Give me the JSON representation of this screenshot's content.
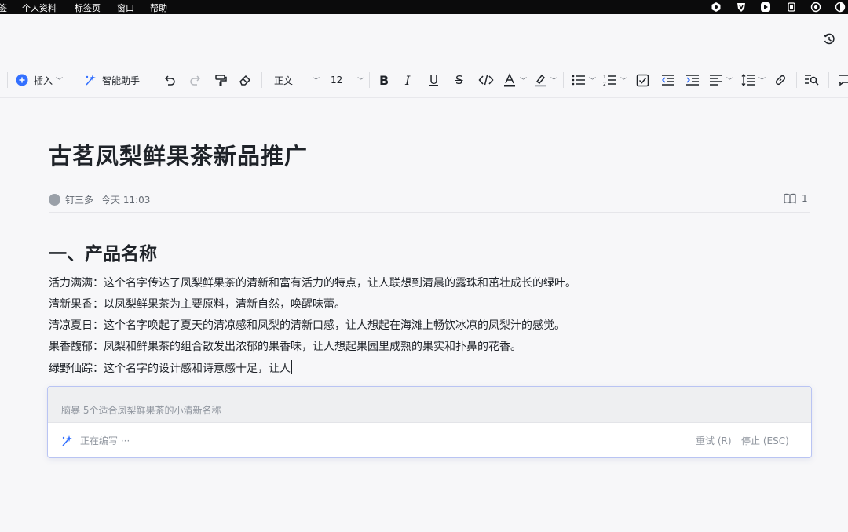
{
  "menubar": {
    "items": [
      "签",
      "个人资料",
      "标签页",
      "窗口",
      "帮助"
    ]
  },
  "toolbar": {
    "insert_label": "插入",
    "assistant_label": "智能助手",
    "style_label": "正文",
    "font_size": "12",
    "icons": [
      "plus-icon",
      "sparkle-icon",
      "undo-icon",
      "redo-icon",
      "format-painter-icon",
      "eraser-icon",
      "bold-icon",
      "italic-icon",
      "underline-icon",
      "strikethrough-icon",
      "code-icon",
      "font-color-icon",
      "highlight-icon",
      "bulleted-list-icon",
      "numbered-list-icon",
      "checkbox-icon",
      "outdent-icon",
      "indent-icon",
      "align-icon",
      "line-spacing-icon",
      "link-icon",
      "find-icon",
      "comment-icon"
    ],
    "accent_color": "#3370ff"
  },
  "document": {
    "title": "古茗凤梨鲜果茶新品推广",
    "author": "钉三多",
    "updated": "今天 11:03",
    "read_count": "1",
    "section_heading": "一、产品名称",
    "paragraphs": [
      "活力满满：这个名字传达了凤梨鲜果茶的清新和富有活力的特点，让人联想到清晨的露珠和茁壮成长的绿叶。",
      "清新果香：以凤梨鲜果茶为主要原料，清新自然，唤醒味蕾。",
      "清凉夏日：这个名字唤起了夏天的清凉感和凤梨的清新口感，让人想起在海滩上畅饮冰凉的凤梨汁的感觉。",
      "果香馥郁：凤梨和鲜果茶的组合散发出浓郁的果香味，让人想起果园里成熟的果实和扑鼻的花香。",
      "绿野仙踪：这个名字的设计感和诗意感十足，让人"
    ]
  },
  "ai_panel": {
    "prompt": "脑暴 5个适合凤梨鲜果茶的小清新名称",
    "status": "正在编写 ···",
    "retry_label": "重试 (R)",
    "stop_label": "停止 (ESC)"
  }
}
